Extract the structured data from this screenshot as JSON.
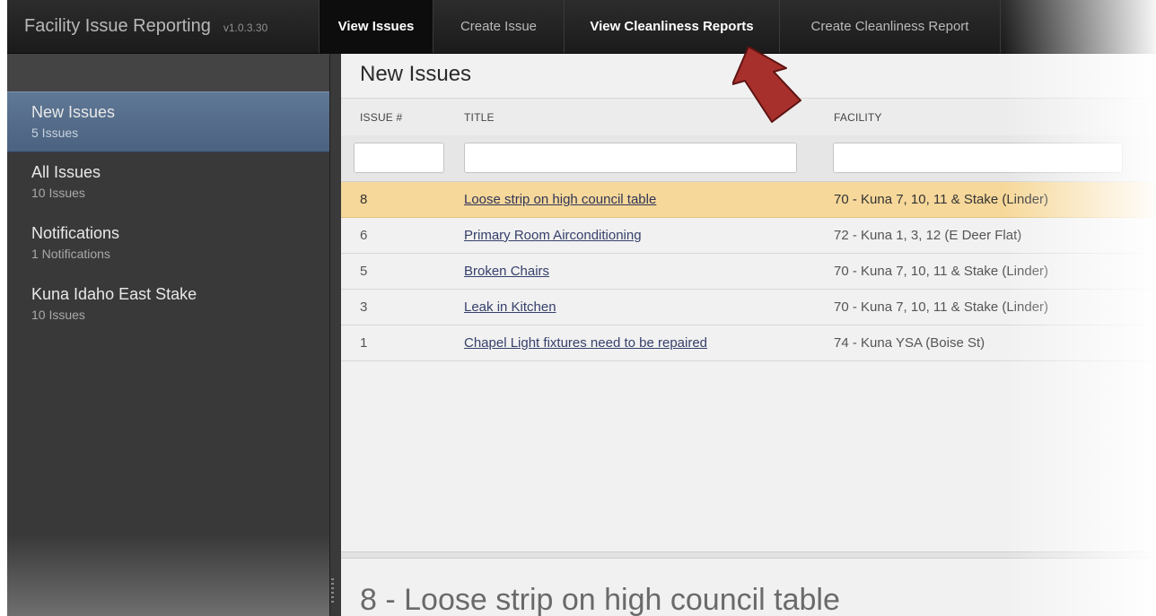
{
  "app": {
    "title": "Facility Issue Reporting",
    "version": "v1.0.3.30"
  },
  "nav": [
    {
      "label": "View Issues",
      "state": "active"
    },
    {
      "label": "Create Issue",
      "state": "normal"
    },
    {
      "label": "View Cleanliness Reports",
      "state": "highlight"
    },
    {
      "label": "Create Cleanliness Report",
      "state": "normal"
    }
  ],
  "sidebar": {
    "items": [
      {
        "label": "New Issues",
        "sub": "5 Issues",
        "active": true
      },
      {
        "label": "All Issues",
        "sub": "10 Issues",
        "active": false
      },
      {
        "label": "Notifications",
        "sub": "1 Notifications",
        "active": false
      },
      {
        "label": "Kuna Idaho East Stake",
        "sub": "10 Issues",
        "active": false
      }
    ]
  },
  "main": {
    "title": "New Issues",
    "columns": {
      "issue": "ISSUE #",
      "title": "TITLE",
      "facility": "FACILITY"
    },
    "rows": [
      {
        "num": "8",
        "title": "Loose strip on high council table",
        "facility": "70 - Kuna 7, 10, 11 & Stake (Linder)",
        "selected": true
      },
      {
        "num": "6",
        "title": "Primary Room Airconditioning",
        "facility": "72 - Kuna 1, 3, 12 (E Deer Flat)",
        "selected": false
      },
      {
        "num": "5",
        "title": "Broken Chairs",
        "facility": "70 - Kuna 7, 10, 11 & Stake (Linder)",
        "selected": false
      },
      {
        "num": "3",
        "title": "Leak in Kitchen",
        "facility": "70 - Kuna 7, 10, 11 & Stake (Linder)",
        "selected": false
      },
      {
        "num": "1",
        "title": "Chapel Light fixtures need to be repaired",
        "facility": "74 - Kuna YSA (Boise St)",
        "selected": false
      }
    ],
    "detail_title": "8 - Loose strip on high council table"
  },
  "colors": {
    "selected_row": "#f6d89a",
    "sidebar_active": "#5a7290",
    "arrow_fill": "#a8302c"
  },
  "annotation": {
    "arrow_icon": "red-arrow-annotation-icon"
  }
}
